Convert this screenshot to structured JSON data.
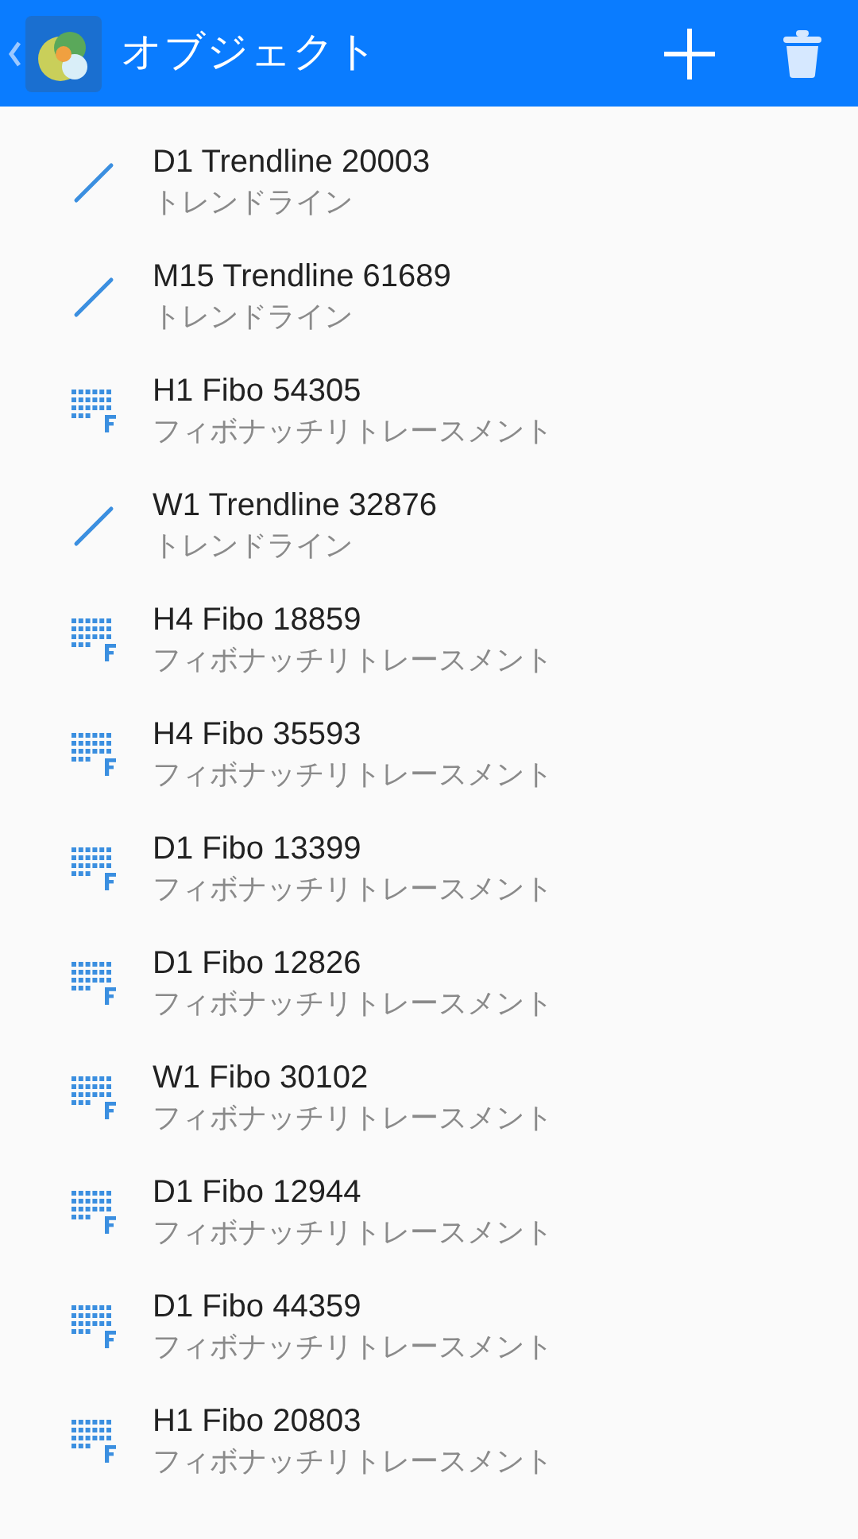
{
  "header": {
    "title": "オブジェクト"
  },
  "objects": [
    {
      "kind": "trendline",
      "name": "D1 Trendline 20003",
      "type": "トレンドライン"
    },
    {
      "kind": "trendline",
      "name": "M15 Trendline 61689",
      "type": "トレンドライン"
    },
    {
      "kind": "fibo",
      "name": "H1 Fibo 54305",
      "type": "フィボナッチリトレースメント"
    },
    {
      "kind": "trendline",
      "name": "W1 Trendline 32876",
      "type": "トレンドライン"
    },
    {
      "kind": "fibo",
      "name": "H4 Fibo 18859",
      "type": "フィボナッチリトレースメント"
    },
    {
      "kind": "fibo",
      "name": "H4 Fibo 35593",
      "type": "フィボナッチリトレースメント"
    },
    {
      "kind": "fibo",
      "name": "D1 Fibo 13399",
      "type": "フィボナッチリトレースメント"
    },
    {
      "kind": "fibo",
      "name": "D1 Fibo 12826",
      "type": "フィボナッチリトレースメント"
    },
    {
      "kind": "fibo",
      "name": "W1 Fibo 30102",
      "type": "フィボナッチリトレースメント"
    },
    {
      "kind": "fibo",
      "name": "D1 Fibo 12944",
      "type": "フィボナッチリトレースメント"
    },
    {
      "kind": "fibo",
      "name": "D1 Fibo 44359",
      "type": "フィボナッチリトレースメント"
    },
    {
      "kind": "fibo",
      "name": "H1 Fibo 20803",
      "type": "フィボナッチリトレースメント"
    }
  ]
}
